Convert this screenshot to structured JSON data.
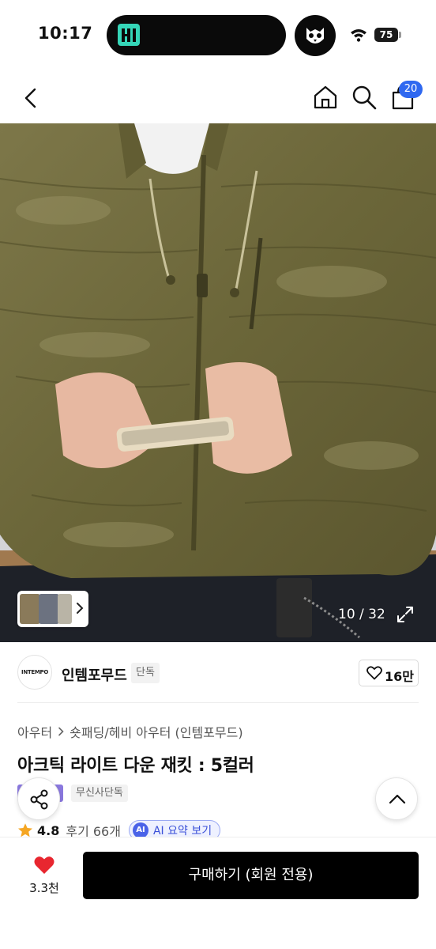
{
  "status_bar": {
    "time": "10:17",
    "battery": "75"
  },
  "header": {
    "cart_count": "20"
  },
  "gallery": {
    "counter": "10 / 32"
  },
  "brand": {
    "logo_text": "INTEMPO",
    "name": "인템포무드",
    "exclusive_label": "단독",
    "likes": "16만"
  },
  "product": {
    "breadcrumb": [
      "아우터",
      "숏패딩/헤비 아우터 (인템포무드)"
    ],
    "title": "아크틱 라이트 다운 재킷 : 5컬러",
    "tag_exclusive": "무신사단독",
    "rating": "4.8",
    "reviews": "후기 66개",
    "ai_badge": "AI",
    "ai_label": "AI 요약 보기"
  },
  "bottom_bar": {
    "wish_count": "3.3천",
    "buy_label": "구매하기 (회원 전용)"
  },
  "colors": {
    "accent_blue": "#2f68f0",
    "jacket_olive": "#6f6a3c",
    "heart_red": "#e8262f",
    "star_orange": "#f5a623",
    "tag_purple": "#8a78de"
  }
}
